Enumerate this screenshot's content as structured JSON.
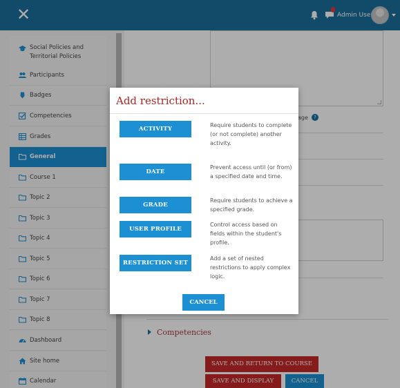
{
  "header": {
    "close_icon": "close-icon",
    "user_name": "Admin User",
    "accent_color": "#1b6e9c"
  },
  "sidebar": {
    "items": [
      {
        "label": "Social Policies and Territorial Policies",
        "icon": "graduation-cap-icon"
      },
      {
        "label": "Participants",
        "icon": "users-icon"
      },
      {
        "label": "Badges",
        "icon": "shield-icon"
      },
      {
        "label": "Competencies",
        "icon": "checkbox-icon"
      },
      {
        "label": "Grades",
        "icon": "table-icon"
      },
      {
        "label": "General",
        "icon": "folder-icon",
        "active": true
      },
      {
        "label": "Course 1",
        "icon": "folder-icon"
      },
      {
        "label": "Topic 2",
        "icon": "folder-icon"
      },
      {
        "label": "Topic 3",
        "icon": "folder-icon"
      },
      {
        "label": "Topic 4",
        "icon": "folder-icon"
      },
      {
        "label": "Topic 5",
        "icon": "folder-icon"
      },
      {
        "label": "Topic 6",
        "icon": "folder-icon"
      },
      {
        "label": "Topic 7",
        "icon": "folder-icon"
      },
      {
        "label": "Topic 8",
        "icon": "folder-icon"
      },
      {
        "label": "Dashboard",
        "icon": "dashboard-icon"
      },
      {
        "label": "Site home",
        "icon": "home-icon"
      },
      {
        "label": "Calendar",
        "icon": "calendar-icon"
      }
    ],
    "active_color": "#1d8fd3"
  },
  "main": {
    "partial_label": "age",
    "competencies_label": "Competencies",
    "buttons": {
      "save_return": "SAVE AND RETURN TO COURSE",
      "save_display": "SAVE AND DISPLAY",
      "cancel": "CANCEL"
    },
    "primary_color": "#c62828"
  },
  "modal": {
    "title": "Add restriction...",
    "restrictions": [
      {
        "button": "ACTIVITY",
        "description": "Require students to complete (or not complete) another activity."
      },
      {
        "button": "DATE",
        "description": "Prevent access until (or from) a specified date and time."
      },
      {
        "button": "GRADE",
        "description": "Require students to achieve a specified grade."
      },
      {
        "button": "USER PROFILE",
        "description": "Control access based on fields within the student's profile."
      },
      {
        "button": "RESTRICTION SET",
        "description": "Add a set of nested restrictions to apply complex logic."
      }
    ],
    "cancel": "CANCEL"
  }
}
